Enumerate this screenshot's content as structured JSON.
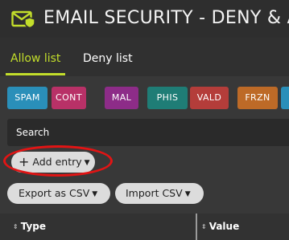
{
  "header": {
    "title": "EMAIL SECURITY - DENY & A",
    "logo_icon": "shield-envelope-icon",
    "accent": "#c3de2b"
  },
  "tabs": [
    {
      "label": "Allow list",
      "active": true
    },
    {
      "label": "Deny list",
      "active": false
    }
  ],
  "chips": [
    {
      "label": "SPAM",
      "color": "#2a8fb9"
    },
    {
      "label": "CONT",
      "color": "#b83167"
    },
    {
      "label": "MAL",
      "color": "#8d2c88"
    },
    {
      "label": "PHIS",
      "color": "#1f7d76"
    },
    {
      "label": "VALD",
      "color": "#b43d3a"
    },
    {
      "label": "FRZN",
      "color": "#bd6a27"
    }
  ],
  "search": {
    "placeholder": "Search"
  },
  "buttons": {
    "add_entry": "Add entry",
    "export_csv": "Export as CSV",
    "import_csv": "Import CSV"
  },
  "table": {
    "columns": [
      "Type",
      "Value"
    ]
  }
}
